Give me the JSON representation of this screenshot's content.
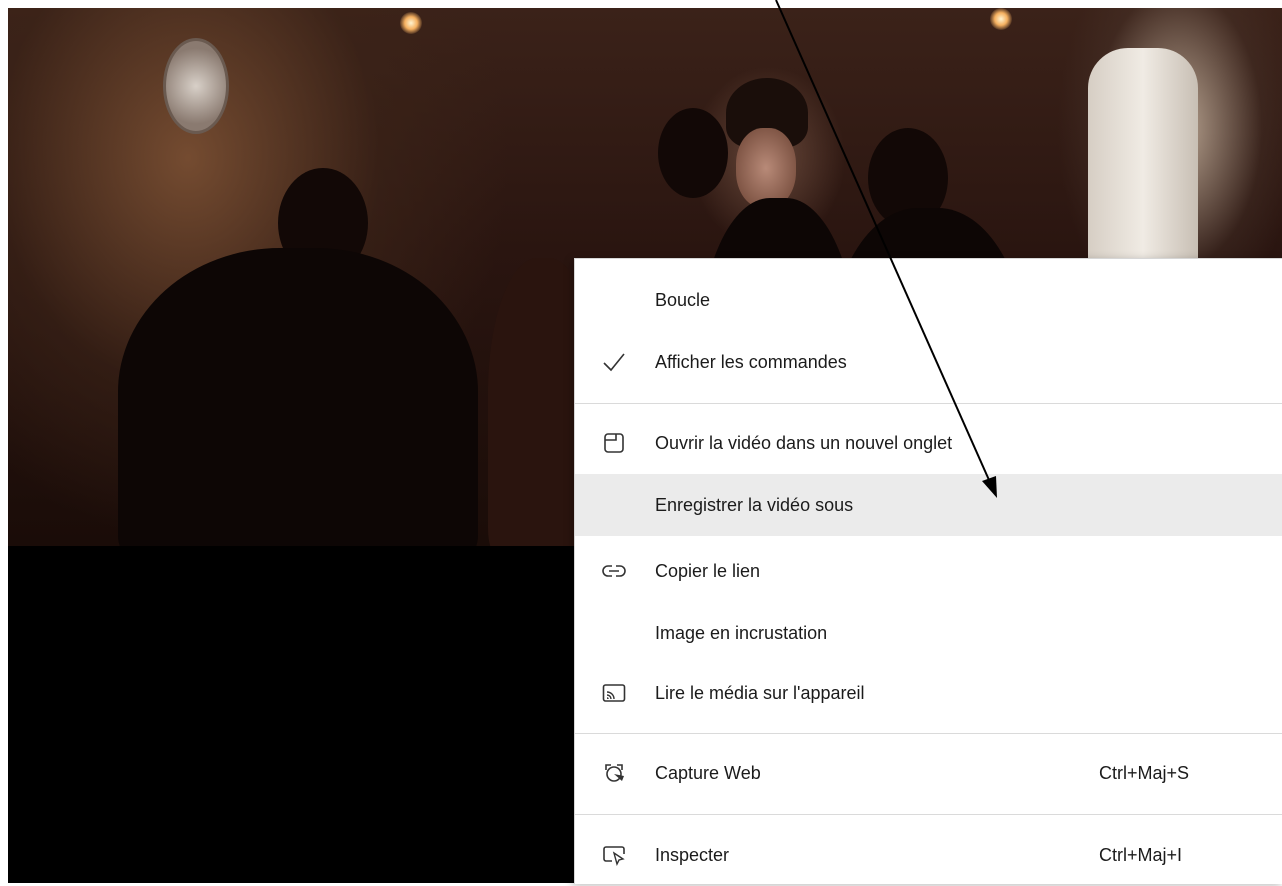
{
  "context_menu": {
    "items": [
      {
        "label": "Boucle",
        "icon": "none"
      },
      {
        "label": "Afficher les commandes",
        "icon": "checkmark-icon"
      },
      {
        "label": "Ouvrir la vidéo dans un nouvel onglet",
        "icon": "new-tab-icon"
      },
      {
        "label": "Enregistrer la vidéo sous",
        "icon": "none",
        "highlighted": true
      },
      {
        "label": "Copier le lien",
        "icon": "link-icon"
      },
      {
        "label": "Image en incrustation",
        "icon": "none"
      },
      {
        "label": "Lire le média sur l'appareil",
        "icon": "cast-icon"
      },
      {
        "label": "Capture Web",
        "icon": "web-capture-icon",
        "shortcut": "Ctrl+Maj+S"
      },
      {
        "label": "Inspecter",
        "icon": "inspect-icon",
        "shortcut": "Ctrl+Maj+I"
      }
    ]
  },
  "colors": {
    "menu_background": "#ffffff",
    "menu_hover": "#ebebeb",
    "separator": "#dadada",
    "text": "#1b1b1b"
  }
}
